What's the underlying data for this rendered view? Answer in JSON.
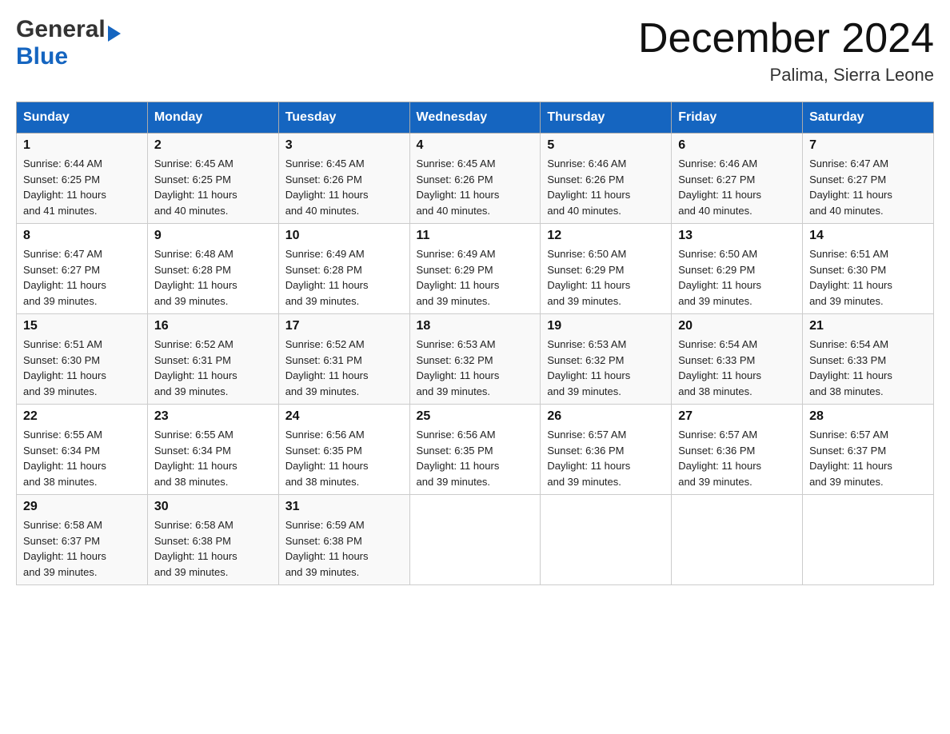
{
  "header": {
    "logo_general": "General",
    "logo_blue": "Blue",
    "month_year": "December 2024",
    "location": "Palima, Sierra Leone"
  },
  "weekdays": [
    "Sunday",
    "Monday",
    "Tuesday",
    "Wednesday",
    "Thursday",
    "Friday",
    "Saturday"
  ],
  "weeks": [
    [
      {
        "day": "1",
        "sunrise": "6:44 AM",
        "sunset": "6:25 PM",
        "daylight": "11 hours and 41 minutes."
      },
      {
        "day": "2",
        "sunrise": "6:45 AM",
        "sunset": "6:25 PM",
        "daylight": "11 hours and 40 minutes."
      },
      {
        "day": "3",
        "sunrise": "6:45 AM",
        "sunset": "6:26 PM",
        "daylight": "11 hours and 40 minutes."
      },
      {
        "day": "4",
        "sunrise": "6:45 AM",
        "sunset": "6:26 PM",
        "daylight": "11 hours and 40 minutes."
      },
      {
        "day": "5",
        "sunrise": "6:46 AM",
        "sunset": "6:26 PM",
        "daylight": "11 hours and 40 minutes."
      },
      {
        "day": "6",
        "sunrise": "6:46 AM",
        "sunset": "6:27 PM",
        "daylight": "11 hours and 40 minutes."
      },
      {
        "day": "7",
        "sunrise": "6:47 AM",
        "sunset": "6:27 PM",
        "daylight": "11 hours and 40 minutes."
      }
    ],
    [
      {
        "day": "8",
        "sunrise": "6:47 AM",
        "sunset": "6:27 PM",
        "daylight": "11 hours and 39 minutes."
      },
      {
        "day": "9",
        "sunrise": "6:48 AM",
        "sunset": "6:28 PM",
        "daylight": "11 hours and 39 minutes."
      },
      {
        "day": "10",
        "sunrise": "6:49 AM",
        "sunset": "6:28 PM",
        "daylight": "11 hours and 39 minutes."
      },
      {
        "day": "11",
        "sunrise": "6:49 AM",
        "sunset": "6:29 PM",
        "daylight": "11 hours and 39 minutes."
      },
      {
        "day": "12",
        "sunrise": "6:50 AM",
        "sunset": "6:29 PM",
        "daylight": "11 hours and 39 minutes."
      },
      {
        "day": "13",
        "sunrise": "6:50 AM",
        "sunset": "6:29 PM",
        "daylight": "11 hours and 39 minutes."
      },
      {
        "day": "14",
        "sunrise": "6:51 AM",
        "sunset": "6:30 PM",
        "daylight": "11 hours and 39 minutes."
      }
    ],
    [
      {
        "day": "15",
        "sunrise": "6:51 AM",
        "sunset": "6:30 PM",
        "daylight": "11 hours and 39 minutes."
      },
      {
        "day": "16",
        "sunrise": "6:52 AM",
        "sunset": "6:31 PM",
        "daylight": "11 hours and 39 minutes."
      },
      {
        "day": "17",
        "sunrise": "6:52 AM",
        "sunset": "6:31 PM",
        "daylight": "11 hours and 39 minutes."
      },
      {
        "day": "18",
        "sunrise": "6:53 AM",
        "sunset": "6:32 PM",
        "daylight": "11 hours and 39 minutes."
      },
      {
        "day": "19",
        "sunrise": "6:53 AM",
        "sunset": "6:32 PM",
        "daylight": "11 hours and 39 minutes."
      },
      {
        "day": "20",
        "sunrise": "6:54 AM",
        "sunset": "6:33 PM",
        "daylight": "11 hours and 38 minutes."
      },
      {
        "day": "21",
        "sunrise": "6:54 AM",
        "sunset": "6:33 PM",
        "daylight": "11 hours and 38 minutes."
      }
    ],
    [
      {
        "day": "22",
        "sunrise": "6:55 AM",
        "sunset": "6:34 PM",
        "daylight": "11 hours and 38 minutes."
      },
      {
        "day": "23",
        "sunrise": "6:55 AM",
        "sunset": "6:34 PM",
        "daylight": "11 hours and 38 minutes."
      },
      {
        "day": "24",
        "sunrise": "6:56 AM",
        "sunset": "6:35 PM",
        "daylight": "11 hours and 38 minutes."
      },
      {
        "day": "25",
        "sunrise": "6:56 AM",
        "sunset": "6:35 PM",
        "daylight": "11 hours and 39 minutes."
      },
      {
        "day": "26",
        "sunrise": "6:57 AM",
        "sunset": "6:36 PM",
        "daylight": "11 hours and 39 minutes."
      },
      {
        "day": "27",
        "sunrise": "6:57 AM",
        "sunset": "6:36 PM",
        "daylight": "11 hours and 39 minutes."
      },
      {
        "day": "28",
        "sunrise": "6:57 AM",
        "sunset": "6:37 PM",
        "daylight": "11 hours and 39 minutes."
      }
    ],
    [
      {
        "day": "29",
        "sunrise": "6:58 AM",
        "sunset": "6:37 PM",
        "daylight": "11 hours and 39 minutes."
      },
      {
        "day": "30",
        "sunrise": "6:58 AM",
        "sunset": "6:38 PM",
        "daylight": "11 hours and 39 minutes."
      },
      {
        "day": "31",
        "sunrise": "6:59 AM",
        "sunset": "6:38 PM",
        "daylight": "11 hours and 39 minutes."
      },
      null,
      null,
      null,
      null
    ]
  ],
  "labels": {
    "sunrise_prefix": "Sunrise: ",
    "sunset_prefix": "Sunset: ",
    "daylight_prefix": "Daylight: "
  }
}
